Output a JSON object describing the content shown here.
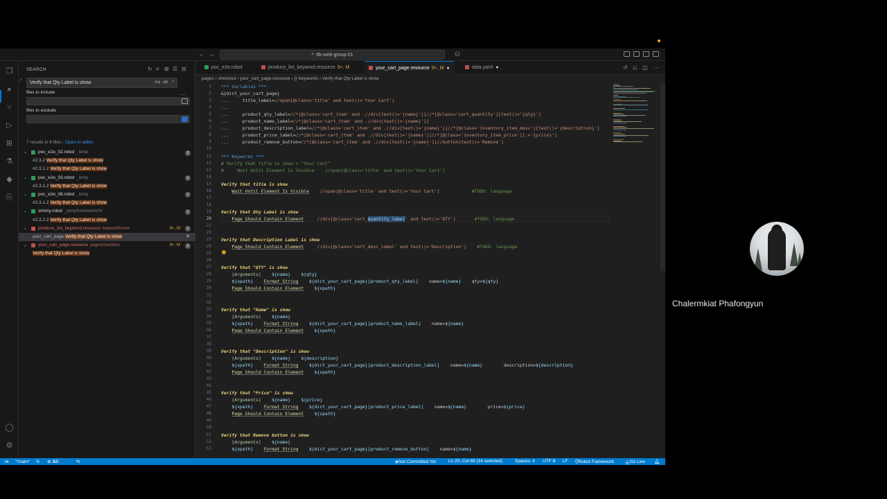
{
  "window": {
    "title": "ttb-web-group-01"
  },
  "activity": [
    "explorer-icon",
    "search-icon",
    "source-control-icon",
    "run-debug-icon",
    "extensions-icon",
    "testing-icon",
    "docker-icon",
    "remote-icon",
    "account-icon",
    "settings-icon"
  ],
  "sidebar": {
    "title": "SEARCH",
    "search_value": "Verify that Qty Label is show",
    "search_opts": [
      "Aa",
      "ab",
      "·*"
    ],
    "files_to_include_label": "files to include",
    "files_to_exclude_label": "files to exclude",
    "results_summary": "7 results in 6 files - ",
    "open_in_editor": "Open in editor",
    "tree": [
      {
        "kind": "file",
        "name": "poc_e2e_02.robot",
        "path": "_temp",
        "badge": "2",
        "red": false
      },
      {
        "kind": "match",
        "prefix": "#2.3.2 ",
        "hit": "Verify that Qty Label is show",
        "suffix": ""
      },
      {
        "kind": "match",
        "prefix": "#2.3.1.2 ",
        "hit": "Verify that Qty Label is show",
        "suffix": ""
      },
      {
        "kind": "file",
        "name": "poc_e2e_03.robot",
        "path": "_temp",
        "badge": "1",
        "red": false
      },
      {
        "kind": "match",
        "prefix": "#2.3.1.2 ",
        "hit": "Verify that Qty Label is show",
        "suffix": ""
      },
      {
        "kind": "file",
        "name": "poc_e2e_06.robot",
        "path": "_temp",
        "badge": "1",
        "red": false
      },
      {
        "kind": "match",
        "prefix": "#2.3.1.2 ",
        "hit": "Verify that Qty Label is show",
        "suffix": ""
      },
      {
        "kind": "file",
        "name": "simmy.robot",
        "path": "_temp/homework/04",
        "badge": "1",
        "red": false
      },
      {
        "kind": "match",
        "prefix": "#2.3.2.2 ",
        "hit": "Verify that Qty Label is show",
        "suffix": ""
      },
      {
        "kind": "file",
        "name": "produce_list_keyword.resource",
        "path": "keyword/home",
        "badge": "1",
        "red": true,
        "mod": "9+, M"
      },
      {
        "kind": "match",
        "prefix": "your_cart_page.",
        "hit": "Verify that Qty Label is show",
        "suffix": "",
        "selected": true
      },
      {
        "kind": "file",
        "name": "your_cart_page.resource",
        "path": "pages/checkout",
        "badge": "1",
        "red": true,
        "mod": "9+, M"
      },
      {
        "kind": "match",
        "prefix": "",
        "hit": "Verify that Qty Label is show",
        "suffix": ""
      }
    ]
  },
  "tabs": [
    {
      "label": "poc_e2e.robot",
      "color": "#2d9d5a",
      "mod": "",
      "active": false
    },
    {
      "label": "produce_list_keyword.resource",
      "color": "#c0504d",
      "mod": "9+, M",
      "active": false
    },
    {
      "label": "your_cart_page.resource",
      "color": "#c0504d",
      "mod": "9+, M",
      "active": true
    },
    {
      "label": "data.yaml",
      "color": "#c0504d",
      "mod": "",
      "active": false
    }
  ],
  "breadcrumb": "pages  ›  checkout  ›  your_cart_page.resource  ›  {} Keywords  ›  Verify that Qty Label is show",
  "code_lines": [
    {
      "n": "1",
      "t": "*** Variables ***"
    },
    {
      "n": "2",
      "t": "&{dict_your_cart_page}"
    },
    {
      "n": "3",
      "t": "...     title_label=//span[@class='title' and text()='Your Cart']"
    },
    {
      "n": "4",
      "t": "..."
    },
    {
      "n": "5",
      "t": "...     product_qty_label=//*[@class='cart_item' and .//div[text()='{name}']]//*[@class='cart_quantity'][text()='{qty}']"
    },
    {
      "n": "6",
      "t": "...     product_name_label=//*[@class='cart_item' and .//div[text()='{name}']]"
    },
    {
      "n": "7",
      "t": "...     product_description_label=//*[@class='cart_item' and .//div[text()='{name}']]//*[@class='inventory_item_desc'][text()='{description}']"
    },
    {
      "n": "8",
      "t": "...     product_price_label=//*[@class='cart_item' and .//div[text()='{name}']]//*[@class='inventory_item_price'][.='{price}']"
    },
    {
      "n": "9",
      "t": "...     product_remove_button=//*[@class='cart_item' and .//div[text()='{name}']]//button[text()='Remove']"
    },
    {
      "n": "10",
      "t": ""
    },
    {
      "n": "11",
      "t": "*** Keywords ***"
    },
    {
      "n": "12",
      "t": "# Verify that title is show = \"Your Cart\""
    },
    {
      "n": "13",
      "t": "#     Wait Until Element Is Visible    //span[@class='title' and text()='Your Cart']"
    },
    {
      "n": "14",
      "t": ""
    },
    {
      "n": "15",
      "t": "Verify that title is show"
    },
    {
      "n": "16",
      "t": "    Wait Until Element Is Visible    //span[@class='title' and text()='Your Cart']            #TODO: language"
    },
    {
      "n": "17",
      "t": ""
    },
    {
      "n": "18",
      "t": ""
    },
    {
      "n": "19",
      "t": "Verify that Qty Label is show"
    },
    {
      "n": "20",
      "t": "    Page Should Contain Element     //div[@class='cart_quantity_label' and text()='QTY']       #TODO: language"
    },
    {
      "n": "21",
      "t": ""
    },
    {
      "n": "22",
      "t": ""
    },
    {
      "n": "23",
      "t": "Verify that Description Label is show"
    },
    {
      "n": "24",
      "t": "    Page Should Contain Element     //div[@class='cart_desc_label' and text()='Description']    #TODO: language"
    },
    {
      "n": "25",
      "t": ""
    },
    {
      "n": "26",
      "t": ""
    },
    {
      "n": "27",
      "t": "Verify that \"QTY\" is show"
    },
    {
      "n": "28",
      "t": "    [Arguments]    ${name}    ${qty}"
    },
    {
      "n": "29",
      "t": "    ${xpath}    Format String    ${dict_your_cart_page}[product_qty_label]    name=${name}    qty=${qty}"
    },
    {
      "n": "30",
      "t": "    Page Should Contain Element    ${xpath}"
    },
    {
      "n": "31",
      "t": ""
    },
    {
      "n": "32",
      "t": ""
    },
    {
      "n": "33",
      "t": "Verify that \"Name\" is show"
    },
    {
      "n": "34",
      "t": "    [Arguments]    ${name}"
    },
    {
      "n": "35",
      "t": "    ${xpath}    Format String    ${dict_your_cart_page}[product_name_label]    name=${name}"
    },
    {
      "n": "36",
      "t": "    Page Should Contain Element    ${xpath}"
    },
    {
      "n": "37",
      "t": ""
    },
    {
      "n": "38",
      "t": ""
    },
    {
      "n": "39",
      "t": "Verify that \"Description\" is show"
    },
    {
      "n": "40",
      "t": "    [Arguments]    ${name}    ${description}"
    },
    {
      "n": "41",
      "t": "    ${xpath}    Format String    ${dict_your_cart_page}[product_description_label]    name=${name}        description=${description}"
    },
    {
      "n": "42",
      "t": "    Page Should Contain Element    ${xpath}"
    },
    {
      "n": "43",
      "t": ""
    },
    {
      "n": "44",
      "t": ""
    },
    {
      "n": "45",
      "t": "Verify that \"Price\" is show"
    },
    {
      "n": "46",
      "t": "    [Arguments]    ${name}    ${price}"
    },
    {
      "n": "47",
      "t": "    ${xpath}    Format String    ${dict_your_cart_page}[product_price_label]    name=${name}        price=${price}"
    },
    {
      "n": "48",
      "t": "    Page Should Contain Element    ${xpath}"
    },
    {
      "n": "49",
      "t": ""
    },
    {
      "n": "50",
      "t": ""
    },
    {
      "n": "51",
      "t": "Verify that Remove button is show"
    },
    {
      "n": "52",
      "t": "    [Arguments]    ${name}"
    },
    {
      "n": "53",
      "t": "    ${xpath}    Format String    ${dict_your_cart_page}[product_remove_button]    name=${name}"
    }
  ],
  "current_line": "20",
  "selected_word": "quantity_label",
  "statusbar": {
    "branch": "main*",
    "errors": "32",
    "warnings": "0",
    "not_committed": "Not Committed Yet",
    "position": "Ln 20, Col 69 (14 selected)",
    "spaces": "Spaces: 4",
    "encoding": "UTF-8",
    "eol": "LF",
    "language": "Robot Framework",
    "golive": "Go Live"
  },
  "participant": {
    "name": "Chalermkiat Phafongyun"
  },
  "colors": {
    "accent": "#0078d4",
    "statusbar": "#007acc",
    "match_highlight": "#ea5c00"
  }
}
